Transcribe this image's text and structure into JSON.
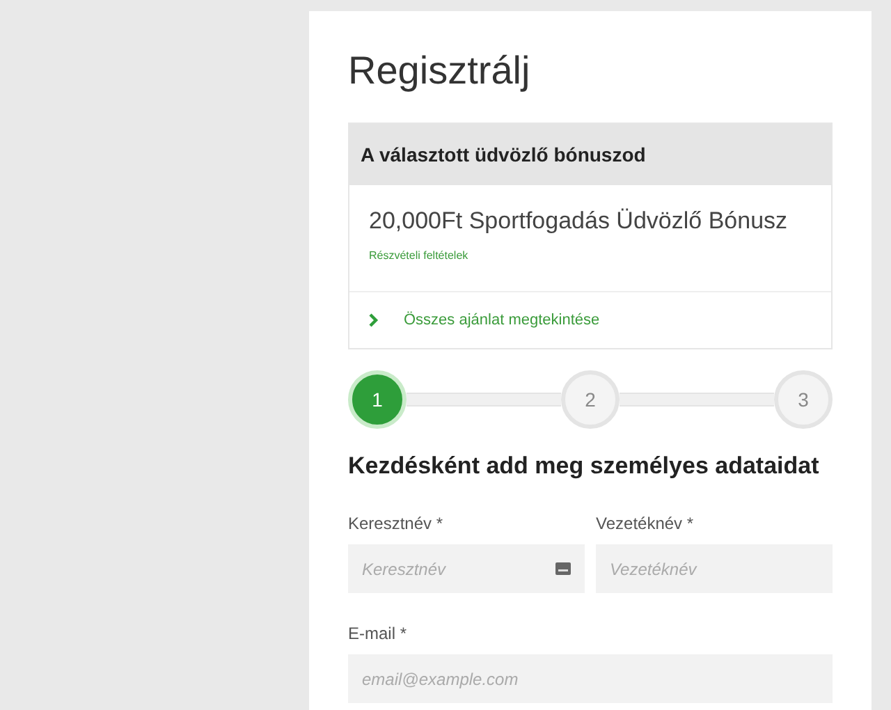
{
  "title": "Regisztrálj",
  "bonus": {
    "header": "A választott üdvözlő bónuszod",
    "name": "20,000Ft Sportfogadás Üdvözlő Bónusz",
    "terms_link": "Részvételi feltételek",
    "all_offers_link": "Összes ajánlat megtekintése"
  },
  "steps": [
    {
      "label": "1",
      "selected": true
    },
    {
      "label": "2",
      "selected": false
    },
    {
      "label": "3",
      "selected": false
    }
  ],
  "section_heading": "Kezdésként add meg személyes adataidat",
  "fields": [
    {
      "label": "Keresztnév *",
      "placeholder": "Keresztnév",
      "kind": "autofill"
    },
    {
      "label": "Vezetéknév *",
      "placeholder": "Vezetéknév",
      "kind": "plain"
    },
    {
      "label": "E-mail *",
      "placeholder": "email@example.com",
      "kind": "wide"
    }
  ]
}
